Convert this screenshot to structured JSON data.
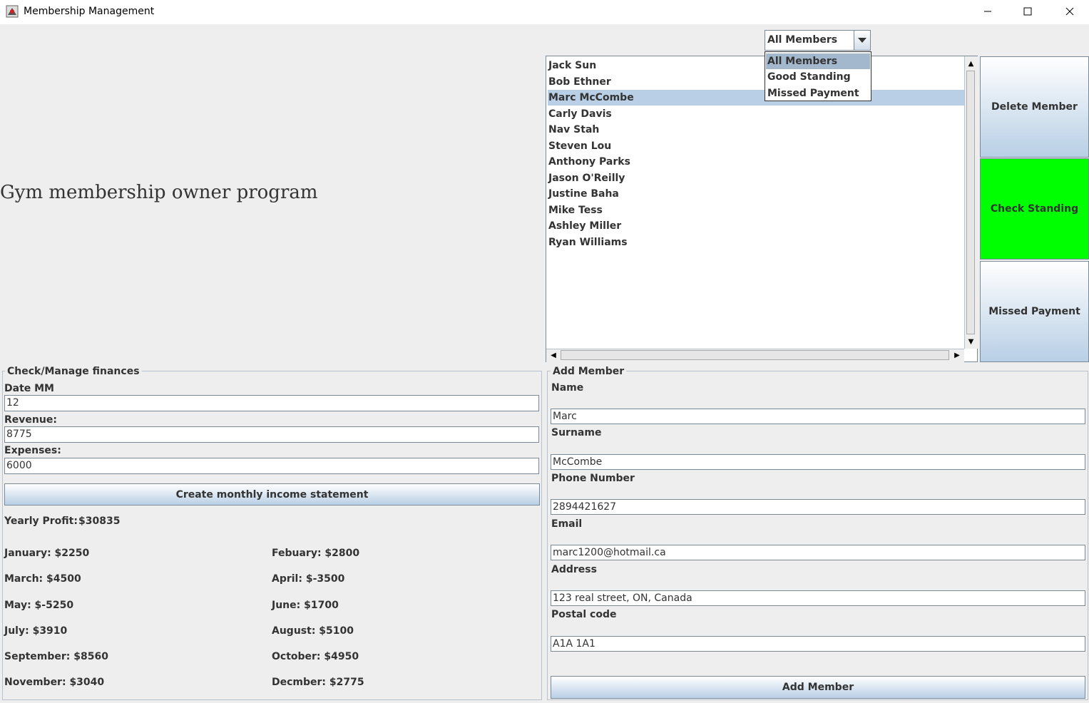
{
  "window": {
    "title": "Membership Management",
    "controls": [
      "minimize-icon",
      "maximize-icon",
      "close-icon"
    ]
  },
  "heading": "Gym membership owner program",
  "filter": {
    "selected": "All Members",
    "options": [
      "All Members",
      "Good Standing",
      "Missed Payment"
    ]
  },
  "members": [
    "Jack Sun",
    "Bob Ethner",
    "Marc McCombe",
    "Carly Davis",
    "Nav Stah",
    "Steven Lou",
    "Anthony Parks",
    "Jason O'Reilly",
    "Justine Baha",
    "Mike Tess",
    "Ashley Miller",
    "Ryan Williams"
  ],
  "selected_member": "Marc McCombe",
  "side_buttons": {
    "delete": "Delete Member",
    "check": "Check Standing",
    "missed": "Missed Payment"
  },
  "colors": {
    "check_standing_bg": "#00ff00",
    "selection": "#b8cfe5"
  },
  "finances": {
    "title": "Check/Manage finances",
    "date_label": "Date MM",
    "date_value": "12",
    "revenue_label": "Revenue:",
    "revenue_value": "8775",
    "expenses_label": "Expenses:",
    "expenses_value": "6000",
    "create_button": "Create monthly income statement",
    "yearly_label": "Yearly Profit:",
    "yearly_value": "$30835",
    "months": [
      "January: $2250",
      "Febuary: $2800",
      "March: $4500",
      "April: $-3500",
      "May: $-5250",
      "June: $1700",
      "July: $3910",
      "August: $5100",
      "September: $8560",
      "October: $4950",
      "November: $3040",
      "Decmber: $2775"
    ]
  },
  "add_member": {
    "title": "Add Member",
    "name_label": "Name",
    "name_value": "Marc",
    "surname_label": "Surname",
    "surname_value": "McCombe",
    "phone_label": "Phone Number",
    "phone_value": "2894421627",
    "email_label": "Email",
    "email_value": "marc1200@hotmail.ca",
    "address_label": "Address",
    "address_value": "123 real street, ON, Canada",
    "postal_label": "Postal code",
    "postal_value": "A1A 1A1",
    "button": "Add Member"
  }
}
